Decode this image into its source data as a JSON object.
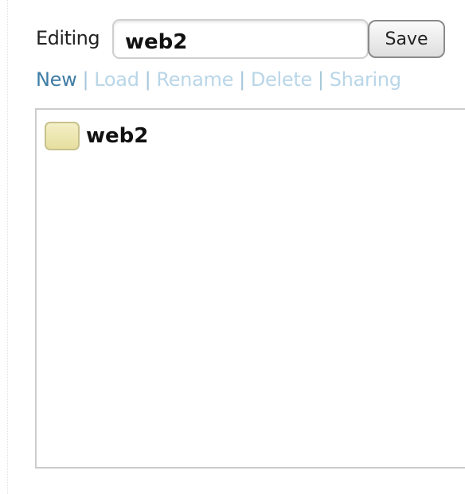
{
  "editor": {
    "editing_label": "Editing",
    "name_value": "web2",
    "save_label": "Save"
  },
  "actions": {
    "new_label": "New",
    "load_label": "Load",
    "rename_label": "Rename",
    "delete_label": "Delete",
    "sharing_label": "Sharing",
    "separator": "|"
  },
  "file_list": {
    "items": [
      {
        "name": "web2",
        "icon": "folder-icon"
      }
    ]
  },
  "colors": {
    "link_active": "#3f7da5",
    "link_disabled": "#b9d6e8",
    "folder_fill": "#f4efc7"
  }
}
